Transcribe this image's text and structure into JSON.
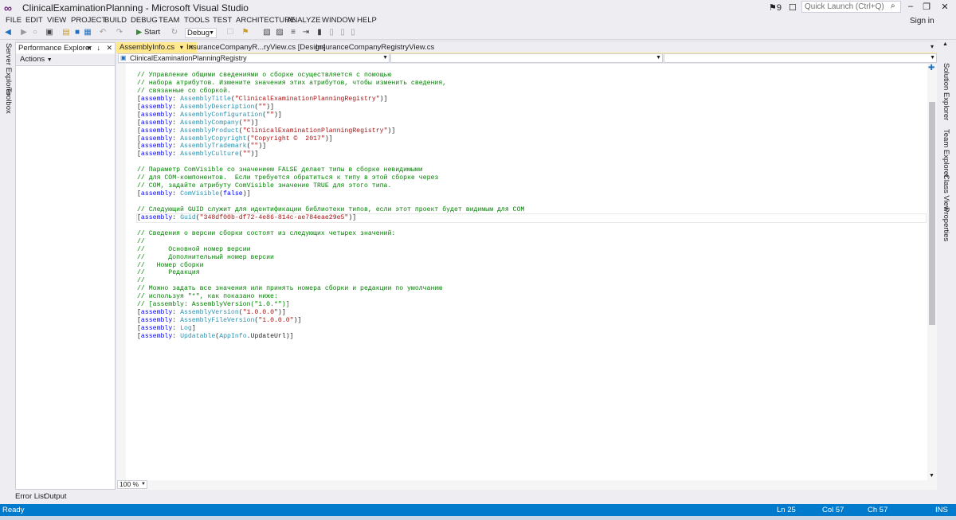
{
  "window": {
    "title": "ClinicalExaminationPlanning - Microsoft Visual Studio",
    "notifications": "9",
    "quick_launch_placeholder": "Quick Launch (Ctrl+Q)",
    "sign_in": "Sign in"
  },
  "menu": [
    "FILE",
    "EDIT",
    "VIEW",
    "PROJECT",
    "BUILD",
    "DEBUG",
    "TEAM",
    "TOOLS",
    "TEST",
    "ARCHITECTURE",
    "ANALYZE",
    "WINDOW",
    "HELP"
  ],
  "toolbar": {
    "start_label": "Start",
    "config_value": "Debug"
  },
  "left_strip": {
    "server_explorer": "Server Explorer",
    "toolbox": "Toolbox"
  },
  "perf_explorer": {
    "title": "Performance Explorer",
    "actions": "Actions"
  },
  "tabs": [
    {
      "label": "AssemblyInfo.cs",
      "active": true
    },
    {
      "label": "InsuranceCompanyR...ryView.cs [Design]",
      "active": false
    },
    {
      "label": "InsuranceCompanyRegistryView.cs",
      "active": false
    }
  ],
  "nav": {
    "project_dropdown": "ClinicalExaminationPlanningRegistry"
  },
  "code_lines": [
    [
      [
        "c-comment",
        "// Управление общими сведениями о сборке осуществляется с помощью"
      ]
    ],
    [
      [
        "c-comment",
        "// набора атрибутов. Измените значения этих атрибутов, чтобы изменить сведения,"
      ]
    ],
    [
      [
        "c-comment",
        "// связанные со сборкой."
      ]
    ],
    [
      [
        "",
        "["
      ],
      [
        "c-kw",
        "assembly"
      ],
      [
        "",
        ": "
      ],
      [
        "c-type",
        "AssemblyTitle"
      ],
      [
        "",
        "("
      ],
      [
        "c-str",
        "\"ClinicalExaminationPlanningRegistry\""
      ],
      [
        "",
        ")]"
      ]
    ],
    [
      [
        "",
        "["
      ],
      [
        "c-kw",
        "assembly"
      ],
      [
        "",
        ": "
      ],
      [
        "c-type",
        "AssemblyDescription"
      ],
      [
        "",
        "("
      ],
      [
        "c-str",
        "\"\""
      ],
      [
        "",
        ")]"
      ]
    ],
    [
      [
        "",
        "["
      ],
      [
        "c-kw",
        "assembly"
      ],
      [
        "",
        ": "
      ],
      [
        "c-type",
        "AssemblyConfiguration"
      ],
      [
        "",
        "("
      ],
      [
        "c-str",
        "\"\""
      ],
      [
        "",
        ")]"
      ]
    ],
    [
      [
        "",
        "["
      ],
      [
        "c-kw",
        "assembly"
      ],
      [
        "",
        ": "
      ],
      [
        "c-type",
        "AssemblyCompany"
      ],
      [
        "",
        "("
      ],
      [
        "c-str",
        "\"\""
      ],
      [
        "",
        ")]"
      ]
    ],
    [
      [
        "",
        "["
      ],
      [
        "c-kw",
        "assembly"
      ],
      [
        "",
        ": "
      ],
      [
        "c-type",
        "AssemblyProduct"
      ],
      [
        "",
        "("
      ],
      [
        "c-str",
        "\"ClinicalExaminationPlanningRegistry\""
      ],
      [
        "",
        ")]"
      ]
    ],
    [
      [
        "",
        "["
      ],
      [
        "c-kw",
        "assembly"
      ],
      [
        "",
        ": "
      ],
      [
        "c-type",
        "AssemblyCopyright"
      ],
      [
        "",
        "("
      ],
      [
        "c-str",
        "\"Copyright ©  2017\""
      ],
      [
        "",
        ")]"
      ]
    ],
    [
      [
        "",
        "["
      ],
      [
        "c-kw",
        "assembly"
      ],
      [
        "",
        ": "
      ],
      [
        "c-type",
        "AssemblyTrademark"
      ],
      [
        "",
        "("
      ],
      [
        "c-str",
        "\"\""
      ],
      [
        "",
        ")]"
      ]
    ],
    [
      [
        "",
        "["
      ],
      [
        "c-kw",
        "assembly"
      ],
      [
        "",
        ": "
      ],
      [
        "c-type",
        "AssemblyCulture"
      ],
      [
        "",
        "("
      ],
      [
        "c-str",
        "\"\""
      ],
      [
        "",
        ")]"
      ]
    ],
    [
      [
        "",
        ""
      ]
    ],
    [
      [
        "c-comment",
        "// Параметр ComVisible со значением FALSE делает типы в сборке невидимыми"
      ]
    ],
    [
      [
        "c-comment",
        "// для COM-компонентов.  Если требуется обратиться к типу в этой сборке через"
      ]
    ],
    [
      [
        "c-comment",
        "// COM, задайте атрибуту ComVisible значение TRUE для этого типа."
      ]
    ],
    [
      [
        "",
        "["
      ],
      [
        "c-kw",
        "assembly"
      ],
      [
        "",
        ": "
      ],
      [
        "c-type",
        "ComVisible"
      ],
      [
        "",
        "("
      ],
      [
        "c-kw",
        "false"
      ],
      [
        "",
        ")]"
      ]
    ],
    [
      [
        "",
        ""
      ]
    ],
    [
      [
        "c-comment",
        "// Следующий GUID служит для идентификации библиотеки типов, если этот проект будет видимым для COM"
      ]
    ],
    [
      [
        "",
        "["
      ],
      [
        "c-kw",
        "assembly"
      ],
      [
        "",
        ": "
      ],
      [
        "c-type",
        "Guid"
      ],
      [
        "",
        "("
      ],
      [
        "c-str",
        "\"348df00b-df72-4e86-814c-ae784eae29e5\""
      ],
      [
        "",
        ")]"
      ]
    ],
    [
      [
        "",
        ""
      ]
    ],
    [
      [
        "c-comment",
        "// Сведения о версии сборки состоят из следующих четырех значений:"
      ]
    ],
    [
      [
        "c-comment",
        "//"
      ]
    ],
    [
      [
        "c-comment",
        "//      Основной номер версии"
      ]
    ],
    [
      [
        "c-comment",
        "//      Дополнительный номер версии"
      ]
    ],
    [
      [
        "c-comment",
        "//   Номер сборки"
      ]
    ],
    [
      [
        "c-comment",
        "//      Редакция"
      ]
    ],
    [
      [
        "c-comment",
        "//"
      ]
    ],
    [
      [
        "c-comment",
        "// Можно задать все значения или принять номера сборки и редакции по умолчанию"
      ]
    ],
    [
      [
        "c-comment",
        "// используя \"*\", как показано ниже:"
      ]
    ],
    [
      [
        "c-comment",
        "// [assembly: AssemblyVersion(\"1.0.*\")]"
      ]
    ],
    [
      [
        "",
        "["
      ],
      [
        "c-kw",
        "assembly"
      ],
      [
        "",
        ": "
      ],
      [
        "c-type",
        "AssemblyVersion"
      ],
      [
        "",
        "("
      ],
      [
        "c-str",
        "\"1.0.0.0\""
      ],
      [
        "",
        ")]"
      ]
    ],
    [
      [
        "",
        "["
      ],
      [
        "c-kw",
        "assembly"
      ],
      [
        "",
        ": "
      ],
      [
        "c-type",
        "AssemblyFileVersion"
      ],
      [
        "",
        "("
      ],
      [
        "c-str",
        "\"1.0.0.0\""
      ],
      [
        "",
        ")]"
      ]
    ],
    [
      [
        "",
        "["
      ],
      [
        "c-kw",
        "assembly"
      ],
      [
        "",
        ": "
      ],
      [
        "c-type",
        "Log"
      ],
      [
        "",
        "]"
      ]
    ],
    [
      [
        "",
        "["
      ],
      [
        "c-kw",
        "assembly"
      ],
      [
        "",
        ": "
      ],
      [
        "c-type",
        "Updatable"
      ],
      [
        "",
        "("
      ],
      [
        "c-type",
        "AppInfo"
      ],
      [
        "",
        ".UpdateUrl)]"
      ]
    ]
  ],
  "current_line_index": 18,
  "zoom": "100 %",
  "right_strip": [
    "Solution Explorer",
    "Team Explorer",
    "Class View",
    "Properties"
  ],
  "bottom_tabs": [
    "Error List",
    "Output"
  ],
  "status": {
    "ready": "Ready",
    "line": "Ln 25",
    "col": "Col 57",
    "ch": "Ch 57",
    "mode": "INS"
  }
}
